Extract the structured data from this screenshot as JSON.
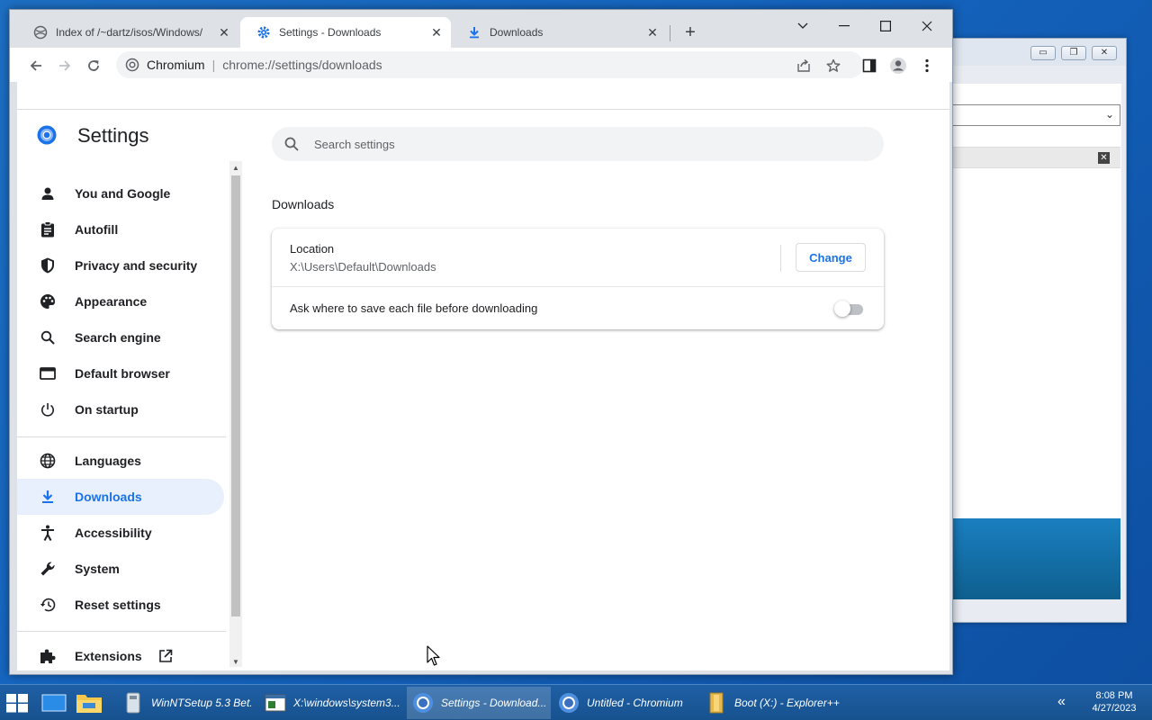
{
  "tabs": [
    {
      "title": "Index of /~dartz/isos/Windows/",
      "icon": "globe-icon",
      "active": false
    },
    {
      "title": "Settings - Downloads",
      "icon": "gear-icon",
      "active": true
    },
    {
      "title": "Downloads",
      "icon": "download-icon",
      "active": false
    }
  ],
  "toolbar": {
    "site_name": "Chromium",
    "url": "chrome://settings/downloads"
  },
  "settings": {
    "title": "Settings",
    "search_placeholder": "Search settings",
    "nav": [
      {
        "label": "You and Google",
        "icon": "person-icon"
      },
      {
        "label": "Autofill",
        "icon": "clipboard-icon"
      },
      {
        "label": "Privacy and security",
        "icon": "shield-icon"
      },
      {
        "label": "Appearance",
        "icon": "palette-icon"
      },
      {
        "label": "Search engine",
        "icon": "search-icon"
      },
      {
        "label": "Default browser",
        "icon": "browser-icon"
      },
      {
        "label": "On startup",
        "icon": "power-icon"
      },
      {
        "label": "Languages",
        "icon": "globe-icon"
      },
      {
        "label": "Downloads",
        "icon": "download-icon",
        "selected": true
      },
      {
        "label": "Accessibility",
        "icon": "accessibility-icon"
      },
      {
        "label": "System",
        "icon": "wrench-icon"
      },
      {
        "label": "Reset settings",
        "icon": "restore-icon"
      },
      {
        "label": "Extensions",
        "icon": "puzzle-icon",
        "external": true
      }
    ],
    "section_title": "Downloads",
    "location_label": "Location",
    "location_path": "X:\\Users\\Default\\Downloads",
    "change_button": "Change",
    "ask_label": "Ask where to save each file before downloading",
    "ask_enabled": false
  },
  "taskbar": {
    "items": [
      {
        "label": "WinNTSetup 5.3 Bet...",
        "icon": "winntsetup-icon"
      },
      {
        "label": "X:\\windows\\system3...",
        "icon": "console-icon"
      },
      {
        "label": "Settings - Download...",
        "icon": "chromium-icon",
        "active": true
      },
      {
        "label": "Untitled - Chromium",
        "icon": "chromium-icon"
      },
      {
        "label": "Boot (X:) - Explorer++",
        "icon": "folder-icon"
      }
    ],
    "time": "8:08 PM",
    "date": "4/27/2023"
  }
}
